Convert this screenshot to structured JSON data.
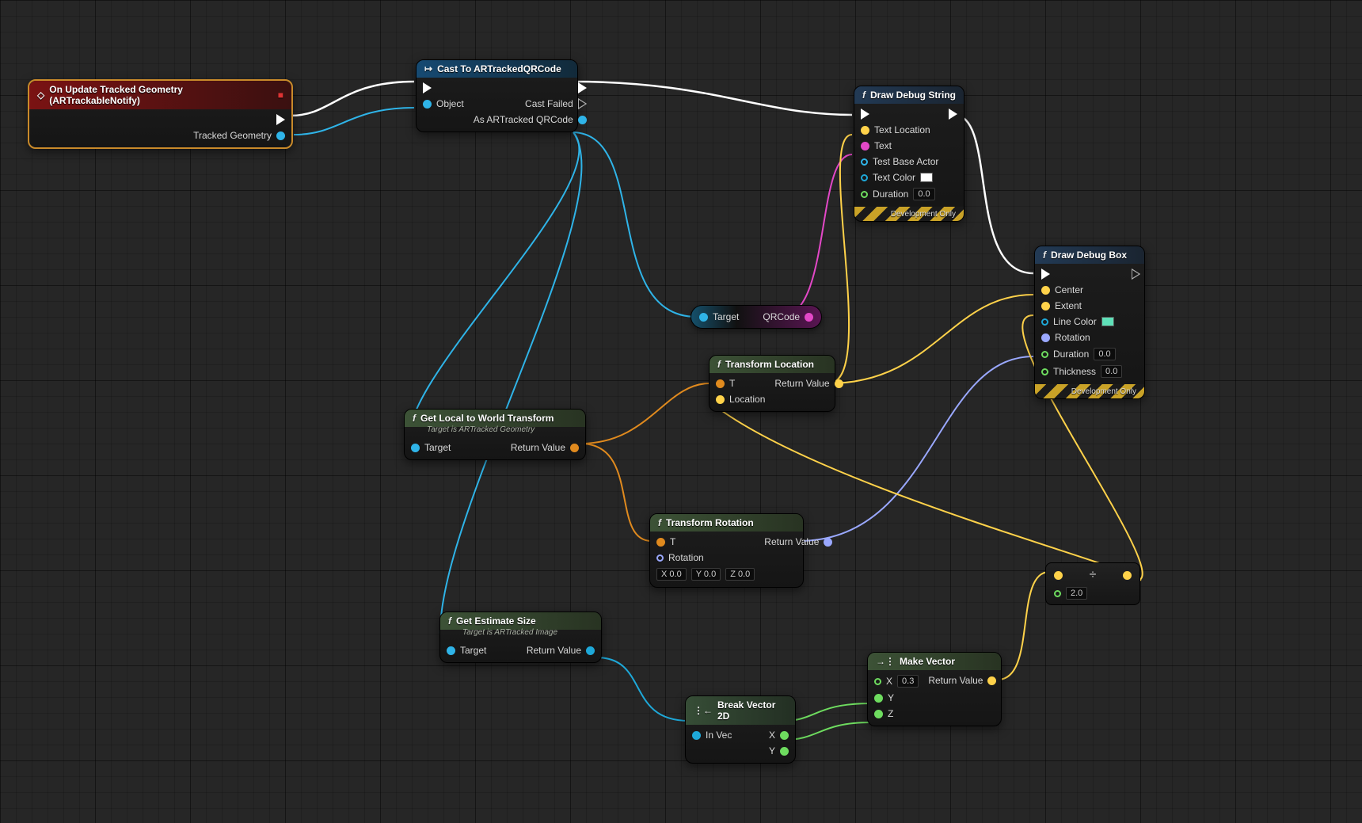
{
  "nodes": {
    "event": {
      "title": "On Update Tracked Geometry (ARTrackableNotify)",
      "out_geom": "Tracked Geometry"
    },
    "cast": {
      "title": "Cast To ARTrackedQRCode",
      "in_obj": "Object",
      "out_fail": "Cast Failed",
      "out_as": "As ARTracked QRCode"
    },
    "drawString": {
      "title": "Draw Debug String",
      "in_textloc": "Text Location",
      "in_text": "Text",
      "in_base": "Test Base Actor",
      "in_color": "Text Color",
      "in_dur": "Duration",
      "dur_val": "0.0",
      "footer": "Development Only"
    },
    "drawBox": {
      "title": "Draw Debug Box",
      "in_center": "Center",
      "in_extent": "Extent",
      "in_linecolor": "Line Color",
      "in_rot": "Rotation",
      "in_dur": "Duration",
      "dur_val": "0.0",
      "in_thick": "Thickness",
      "thick_val": "0.0",
      "footer": "Development Only"
    },
    "qrcode": {
      "in": "Target",
      "out": "QRCode"
    },
    "l2w": {
      "title": "Get Local to World Transform",
      "subtitle": "Target is ARTracked Geometry",
      "in": "Target",
      "out": "Return Value"
    },
    "estSize": {
      "title": "Get Estimate Size",
      "subtitle": "Target is ARTracked Image",
      "in": "Target",
      "out": "Return Value"
    },
    "tLoc": {
      "title": "Transform Location",
      "in_t": "T",
      "in_loc": "Location",
      "out": "Return Value"
    },
    "tRot": {
      "title": "Transform Rotation",
      "in_t": "T",
      "in_rot": "Rotation",
      "rot_x": "0.0",
      "rot_y": "0.0",
      "rot_z": "0.0",
      "out": "Return Value"
    },
    "breakV2": {
      "title": "Break Vector 2D",
      "in": "In Vec",
      "out_x": "X",
      "out_y": "Y"
    },
    "makeVec": {
      "title": "Make Vector",
      "in_x": "X",
      "x_val": "0.3",
      "in_y": "Y",
      "in_z": "Z",
      "out": "Return Value"
    },
    "divide": {
      "b_val": "2.0",
      "op": "÷"
    }
  },
  "colors": {
    "textColorSwatch": "#ffffff",
    "lineColorSwatch": "#5fe0b8"
  }
}
